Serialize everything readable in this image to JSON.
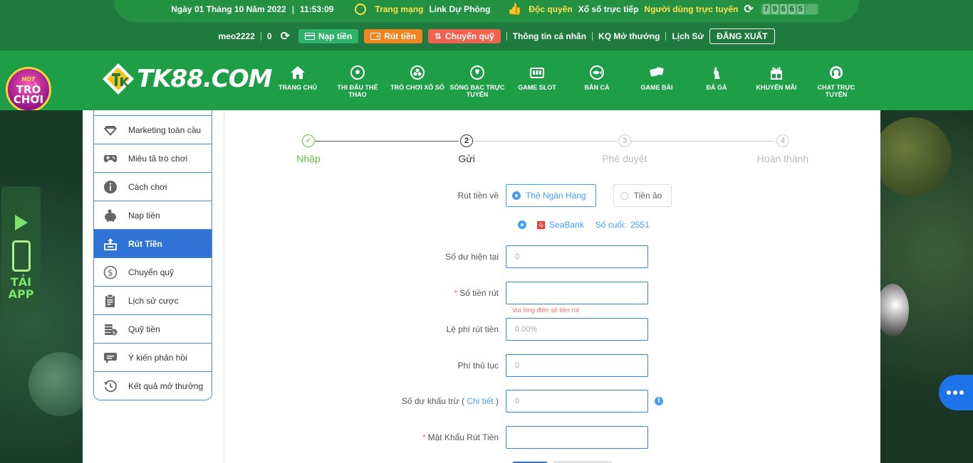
{
  "topbar": {
    "date": "Ngày 01 Tháng 10 Năm 2022",
    "time": "11:53:09",
    "network_label": "Trang mạng",
    "backup_link": "Link Dự Phòng",
    "exclusive_label": "Độc quyền",
    "lottery_live": "Xổ số trực tiếp",
    "online_label": "Người dùng trực tuyến",
    "online_digits": [
      "7",
      "9",
      "6",
      "6",
      "5"
    ]
  },
  "account": {
    "username": "meo2222",
    "balance": "0",
    "deposit_label": "Nạp tiền",
    "withdraw_label": "Rút tiền",
    "transfer_label": "Chuyển quỹ",
    "profile_label": "Thông tin cá nhân",
    "results_label": "KQ Mở thưởng",
    "history_label": "Lịch Sử",
    "logout_label": "ĐĂNG XUẤT"
  },
  "brand": {
    "logo_text": "TK88.COM",
    "game_badge_hot": "HOT",
    "game_badge_line1": "TRÒ",
    "game_badge_line2": "CHƠI",
    "app_line1": "TẢI",
    "app_line2": "APP"
  },
  "nav": {
    "items": [
      {
        "label": "TRANG CHỦ",
        "icon": "home-icon"
      },
      {
        "label": "THI ĐẤU THỂ THAO",
        "icon": "soccer-ball-icon"
      },
      {
        "label": "TRÒ CHƠI XỔ SỐ",
        "icon": "lottery-icon"
      },
      {
        "label": "SÒNG BẠC TRỰC TUYẾN",
        "icon": "casino-chip-icon"
      },
      {
        "label": "GAME SLOT",
        "icon": "slot-machine-icon"
      },
      {
        "label": "BẮN CÁ",
        "icon": "fish-icon"
      },
      {
        "label": "GAME BÀI",
        "icon": "dice-icon"
      },
      {
        "label": "ĐÁ GÀ",
        "icon": "rooster-icon"
      },
      {
        "label": "KHUYẾN MÃI",
        "icon": "gift-icon"
      },
      {
        "label": "CHAT TRỰC TUYẾN",
        "icon": "headset-icon"
      }
    ]
  },
  "sidebar": {
    "items": [
      {
        "label": "Marketing toàn cầu",
        "icon": "diamond-icon",
        "active": false
      },
      {
        "label": "Miêu tả trò chơi",
        "icon": "gamepad-icon",
        "active": false
      },
      {
        "label": "Cách chơi",
        "icon": "info-icon",
        "active": false
      },
      {
        "label": "Nạp tiền",
        "icon": "piggy-bank-icon",
        "active": false
      },
      {
        "label": "Rút Tiền",
        "icon": "withdraw-icon",
        "active": true
      },
      {
        "label": "Chuyển quỹ",
        "icon": "dollar-circle-icon",
        "active": false
      },
      {
        "label": "Lịch sử cược",
        "icon": "clipboard-icon",
        "active": false
      },
      {
        "label": "Quỹ tiền",
        "icon": "coins-icon",
        "active": false
      },
      {
        "label": "Ý kiến phản hồi",
        "icon": "chat-icon",
        "active": false
      },
      {
        "label": "Kết quả mở thưởng",
        "icon": "history-icon",
        "active": false
      }
    ]
  },
  "stepper": {
    "steps": [
      {
        "num": "✓",
        "label": "Nhập",
        "state": "done"
      },
      {
        "num": "2",
        "label": "Gửi",
        "state": "current"
      },
      {
        "num": "3",
        "label": "Phê duyệt",
        "state": "pending"
      },
      {
        "num": "4",
        "label": "Hoàn thành",
        "state": "pending"
      }
    ]
  },
  "form": {
    "withdraw_to_label": "Rút tiền về",
    "option_bank": "Thẻ Ngân Hàng",
    "option_crypto": "Tiền ảo",
    "bank_name": "SeaBank",
    "last_digits_label": "Số cuối:",
    "last_digits": "2551",
    "balance_label": "Số dư hiện tại",
    "balance_value": "0",
    "amount_label": "Số tiền rút",
    "amount_value": "",
    "amount_error": "Vui lòng điền số tiền rút",
    "fee_label": "Lệ phí rút tiền",
    "fee_value": "0.00%",
    "proc_fee_label": "Phí thủ tục",
    "proc_fee_value": "0",
    "deduct_label": "Số dư khấu trừ",
    "deduct_link": "Chi tiết",
    "deduct_value": "0",
    "password_label": "Mật Khẩu Rút Tiền",
    "password_value": ""
  },
  "colors": {
    "topbar": "#1f7a3e",
    "nav": "#1f9e48",
    "accent_blue": "#409eff",
    "active_sidebar": "#2f73d6",
    "error": "#f56c6c"
  }
}
